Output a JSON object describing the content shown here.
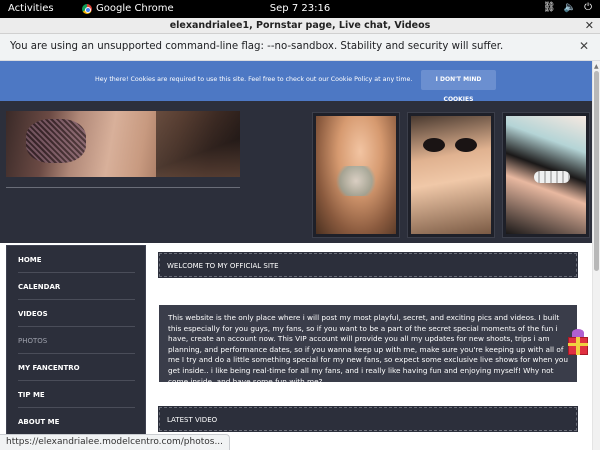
{
  "system_bar": {
    "activities": "Activities",
    "app_name": "Google Chrome",
    "clock": "Sep 7  23:16",
    "icons": [
      "network-icon",
      "volume-icon",
      "power-icon"
    ]
  },
  "browser": {
    "window_title": "elexandrialee1, Pornstar page, Live chat, Videos",
    "infobar_message": "You are using an unsupported command-line flag: --no-sandbox. Stability and security will suffer.",
    "status_url": "https://elexandrialee.modelcentro.com/photos..."
  },
  "cookie_banner": {
    "text": "Hey there! Cookies are required to use this site. Feel free to check out our Cookie Policy at any time.",
    "button_label": "I DON'T MIND COOKIES"
  },
  "nav": {
    "items": [
      {
        "label": "HOME"
      },
      {
        "label": "CALENDAR"
      },
      {
        "label": "VIDEOS"
      },
      {
        "label": "PHOTOS"
      },
      {
        "label": "MY FANCENTRO"
      },
      {
        "label": "TIP ME"
      },
      {
        "label": "ABOUT ME"
      }
    ]
  },
  "content": {
    "welcome_title": "WELCOME TO MY OFFICIAL SITE",
    "intro_text": "This website is the only place where i will post my most playful, secret, and exciting pics and videos. I built this especially for you guys, my fans, so if you want to be a part of the secret special moments of the fun i have, create an account now. This VIP account will provide you all my updates for new shoots, trips i am planning, and performance dates, so if you wanna keep up with me, make sure you're keeping up with all of me I try and do a little something special for my new fans, so expect some exclusive live shows for when you get inside.. i like being real-time for all my fans, and i really like having fun and enjoying myself! Why not come inside, and have some fun with me?",
    "latest_title": "LATEST VIDEO"
  },
  "colors": {
    "header_bg": "#2c2f3b",
    "cookie_bg": "#4d78c4",
    "text_box_bg": "#3a3d4a"
  }
}
